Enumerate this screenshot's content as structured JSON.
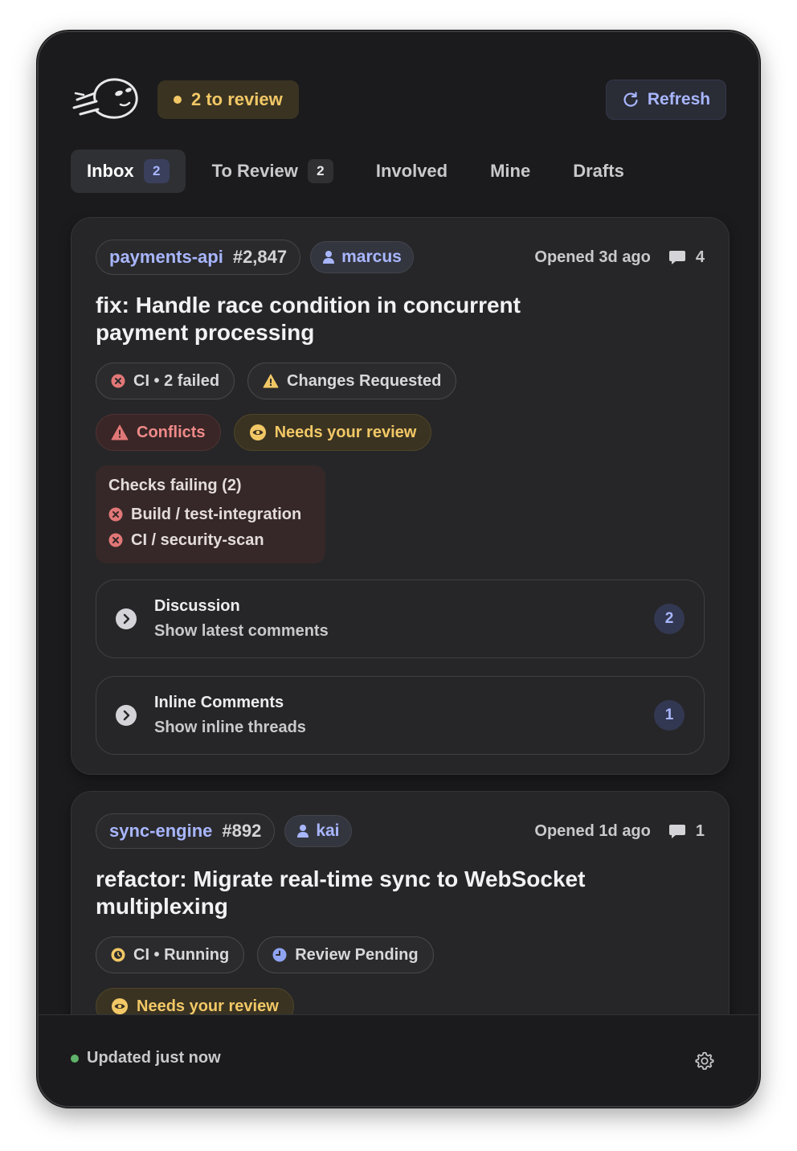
{
  "header": {
    "review_count_label": "2 to review",
    "refresh_label": "Refresh"
  },
  "tabs": [
    {
      "label": "Inbox",
      "count": "2",
      "active": true
    },
    {
      "label": "To Review",
      "count": "2"
    },
    {
      "label": "Involved"
    },
    {
      "label": "Mine"
    },
    {
      "label": "Drafts"
    }
  ],
  "prs": [
    {
      "repo": "payments-api",
      "number": "#2,847",
      "author": "marcus",
      "opened": "Opened 3d ago",
      "comments": "4",
      "title": "fix: Handle race condition in concurrent payment processing",
      "ci_status": "CI • 2 failed",
      "review_status": "Changes Requested",
      "conflicts": "Conflicts",
      "needs_review": "Needs your review",
      "checks": {
        "title": "Checks failing (2)",
        "items": [
          "Build / test-integration",
          "CI / security-scan"
        ]
      },
      "discussion": {
        "label": "Discussion",
        "sub": "Show latest comments",
        "count": "2"
      },
      "inline": {
        "label": "Inline Comments",
        "sub": "Show inline threads",
        "count": "1"
      }
    },
    {
      "repo": "sync-engine",
      "number": "#892",
      "author": "kai",
      "opened": "Opened 1d ago",
      "comments": "1",
      "title": "refactor: Migrate real-time sync to WebSocket multiplexing",
      "ci_status": "CI • Running",
      "review_status": "Review Pending",
      "needs_review": "Needs your review"
    }
  ],
  "footer": {
    "status": "Updated just now"
  },
  "colors": {
    "accent": "#a8b6ff",
    "warning": "#f2c866",
    "danger": "#f08a8a",
    "success": "#5fb36a"
  }
}
